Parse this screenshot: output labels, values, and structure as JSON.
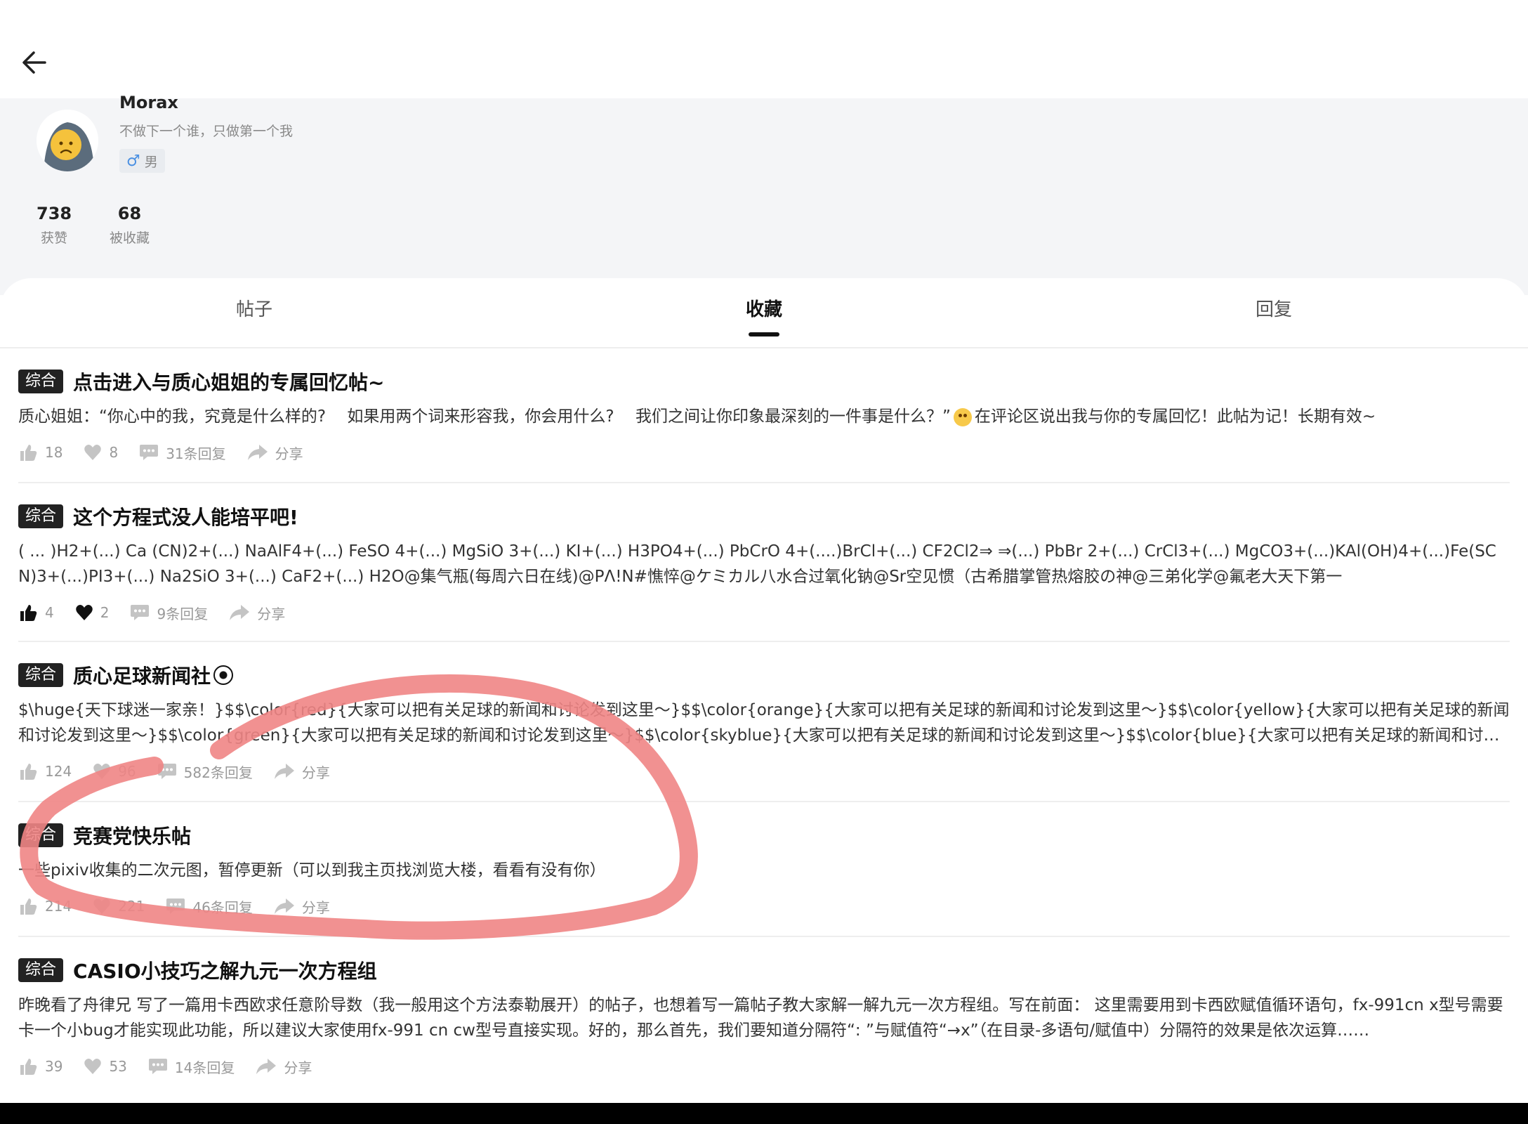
{
  "profile": {
    "username": "Morax",
    "signature": "不做下一个谁，只做第一个我",
    "gender_label": "男",
    "stats": [
      {
        "value": "738",
        "label": "获赞"
      },
      {
        "value": "68",
        "label": "被收藏"
      }
    ]
  },
  "tabs": [
    {
      "label": "帖子",
      "active": false
    },
    {
      "label": "收藏",
      "active": true
    },
    {
      "label": "回复",
      "active": false
    }
  ],
  "posts": [
    {
      "tag": "综合",
      "title": "点击进入与质心姐姐的专属回忆帖~",
      "content_before": "质心姐姐：“你心中的我，究竟是什么样的?　  如果用两个词来形容我，你会用什么?　  我们之间让你印象最深刻的一件事是什么？”",
      "content_after": "在评论区说出我与你的专属回忆！此帖为记！长期有效~",
      "likes": "18",
      "favorites": "8",
      "replies": "31条回复",
      "share": "分享"
    },
    {
      "tag": "综合",
      "title": "这个方程式没人能培平吧!",
      "content": "( ... )H2+(...) Ca (CN)2+(...) NaAlF4+(...) FeSO 4+(...) MgSiO 3+(...) KI+(...) H3PO4+(...) PbCrO 4+(....)BrCl+(...) CF2Cl2⇒ ⇒(...) PbBr 2+(...) CrCl3+(...) MgCO3+(...)KAl(OH)4+(...)Fe(SCN)3+(...)PI3+(...) Na2SiO 3+(...) CaF2+(...) H2O@集气瓶(每周六日在线)@PΛ!N#憔悴@ケミカル八水合过氧化钠@Sr空见惯（古希腊掌管热熔胶の神@三弟化学@氟老大天下第一",
      "likes": "4",
      "favorites": "2",
      "replies": "9条回复",
      "share": "分享"
    },
    {
      "tag": "综合",
      "title": "质心足球新闻社",
      "content": "$\\huge{天下球迷一家亲！}$$\\color{red}{大家可以把有关足球的新闻和讨论发到这里～}$$\\color{orange}{大家可以把有关足球的新闻和讨论发到这里～}$$\\color{yellow}{大家可以把有关足球的新闻和讨论发到这里～}$$\\color{green}{大家可以把有关足球的新闻和讨论发到这里～}$$\\color{skyblue}{大家可以把有关足球的新闻和讨论发到这里～}$$\\color{blue}{大家可以把有关足球的新闻和讨论发到这里～}$",
      "likes": "124",
      "favorites": "96",
      "replies": "582条回复",
      "share": "分享"
    },
    {
      "tag": "综合",
      "title": "竞赛党快乐帖",
      "content": "一些pixiv收集的二次元图，暂停更新（可以到我主页找浏览大楼，看看有没有你）",
      "likes": "214",
      "favorites": "221",
      "replies": "46条回复",
      "share": "分享"
    },
    {
      "tag": "综合",
      "title": "CASIO小技巧之解九元一次方程组",
      "content": "昨晚看了舟律兄 写了一篇用卡西欧求任意阶导数（我一般用这个方法泰勒展开）的帖子，也想着写一篇帖子教大家解一解九元一次方程组。写在前面： 这里需要用到卡西欧赋值循环语句，fx-991cn x型号需要卡一个小bug才能实现此功能，所以建议大家使用fx-991 cn cw型号直接实现。好的，那么首先，我们要知道分隔符“: ”与赋值符“→x”（在目录-多语句/赋值中）分隔符的效果是依次运算……",
      "likes": "39",
      "favorites": "53",
      "replies": "14条回复",
      "share": "分享"
    }
  ],
  "colors": {
    "annotation": "#f08585",
    "tag_bg": "#222222",
    "header_bg": "#f4f5f7",
    "gender_icon": "#4a90e2"
  },
  "icons": [
    "back-arrow-icon",
    "male-icon",
    "thumb-up-icon",
    "heart-icon",
    "comment-icon",
    "share-icon",
    "smiling-face-with-hearts-icon",
    "soccer-ball-icon"
  ]
}
